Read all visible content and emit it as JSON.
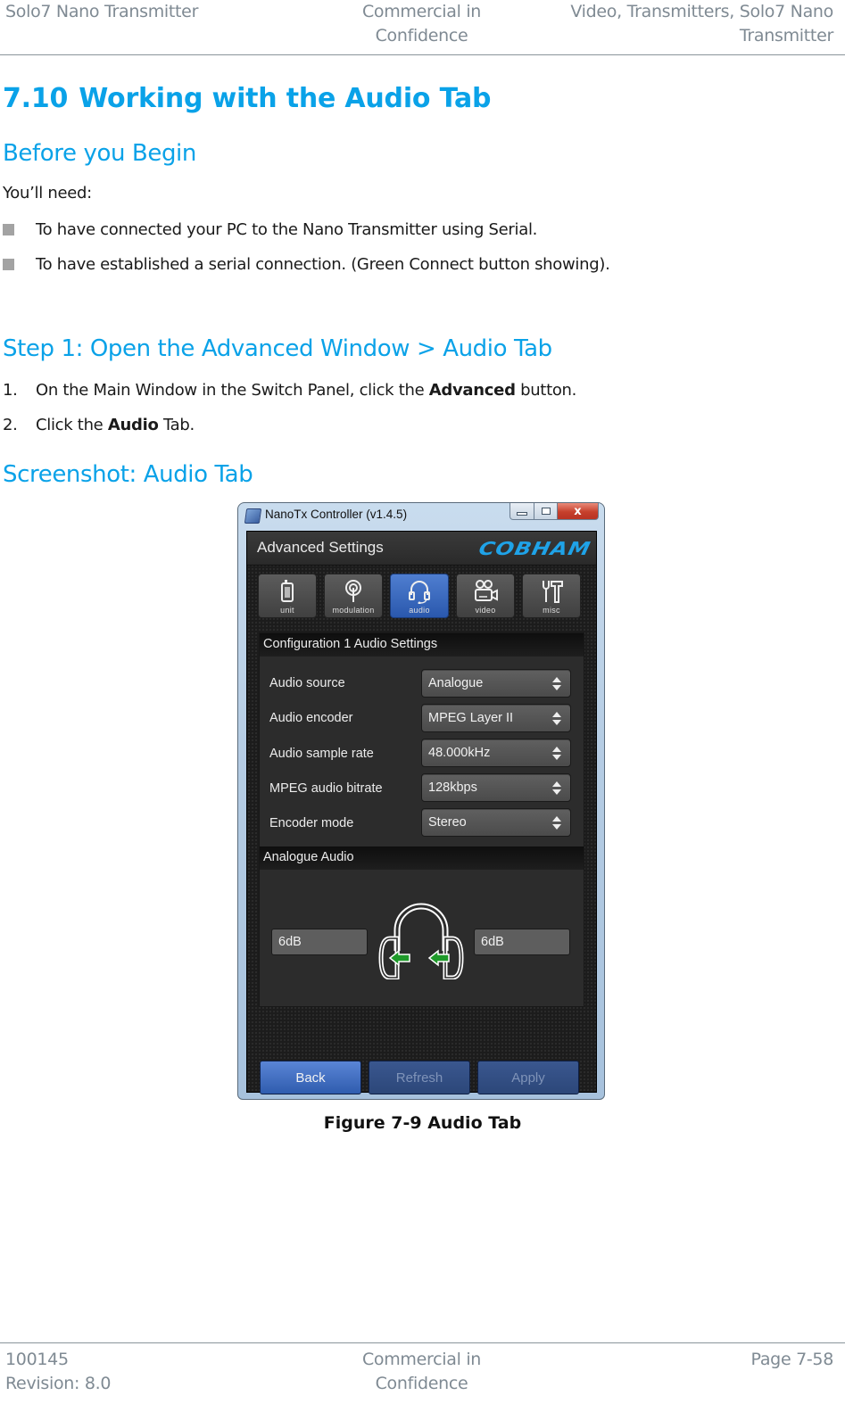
{
  "header": {
    "left": "Solo7 Nano Transmitter",
    "center_line1": "Commercial in",
    "center_line2": "Confidence",
    "right_line1": "Video, Transmitters, Solo7 Nano",
    "right_line2": "Transmitter"
  },
  "section": {
    "number": "7.10",
    "title": "Working with the Audio Tab"
  },
  "before_you_begin": {
    "heading": "Before you Begin",
    "intro": "You’ll need:",
    "bullets": [
      "To have connected your PC to the Nano Transmitter using Serial.",
      "To have established a serial connection. (Green Connect button showing)."
    ]
  },
  "step1": {
    "heading": "Step 1: Open the Advanced Window > Audio Tab",
    "items": [
      {
        "num": "1.",
        "pre": "On the Main Window in the Switch Panel, click the ",
        "bold": "Advanced",
        "post": " button."
      },
      {
        "num": "2.",
        "pre": "Click the ",
        "bold": "Audio",
        "post": " Tab."
      }
    ]
  },
  "screenshot_heading": "Screenshot: Audio Tab",
  "app": {
    "window_title": "NanoTx Controller (v1.4.5)",
    "close_glyph": "x",
    "panel_title": "Advanced Settings",
    "logo": "COBHAM",
    "tabs": [
      {
        "label": "unit",
        "icon": "unit-device-icon",
        "active": false
      },
      {
        "label": "modulation",
        "icon": "antenna-icon",
        "active": false
      },
      {
        "label": "audio",
        "icon": "headset-icon",
        "active": true
      },
      {
        "label": "video",
        "icon": "video-camera-icon",
        "active": false
      },
      {
        "label": "misc",
        "icon": "tools-icon",
        "active": false
      }
    ],
    "config_section_title": "Configuration 1 Audio Settings",
    "settings": [
      {
        "label": "Audio source",
        "value": "Analogue"
      },
      {
        "label": "Audio encoder",
        "value": "MPEG Layer II"
      },
      {
        "label": "Audio sample rate",
        "value": "48.000kHz"
      },
      {
        "label": "MPEG audio bitrate",
        "value": "128kbps"
      },
      {
        "label": "Encoder mode",
        "value": "Stereo"
      }
    ],
    "analogue_section_title": "Analogue Audio",
    "left_gain": "6dB",
    "right_gain": "6dB",
    "buttons": {
      "back": "Back",
      "refresh": "Refresh",
      "apply": "Apply"
    },
    "colors": {
      "accent_blue": "#2f5cae",
      "logo_blue": "#1fa3e8",
      "arrow_green": "#1f9a2a"
    }
  },
  "caption": "Figure 7-9 Audio Tab",
  "footer": {
    "doc_number": "100145",
    "revision": "Revision: 8.0",
    "center_line1": "Commercial in",
    "center_line2": "Confidence",
    "page": "Page 7-58"
  },
  "colors": {
    "heading_blue": "#0aa2e8",
    "header_gray": "#7f8a93",
    "bullet_gray": "#a3a3a3"
  }
}
